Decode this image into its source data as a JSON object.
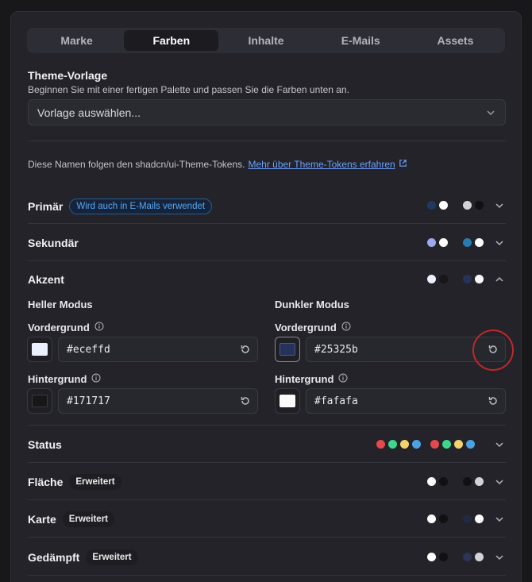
{
  "tabs": [
    "Marke",
    "Farben",
    "Inhalte",
    "E-Mails",
    "Assets"
  ],
  "active_tab": "Farben",
  "theme": {
    "title": "Theme-Vorlage",
    "description": "Beginnen Sie mit einer fertigen Palette und passen Sie die Farben unten an.",
    "select_placeholder": "Vorlage auswählen..."
  },
  "tokens_note": {
    "text": "Diese Namen folgen den shadcn/ui-Theme-Tokens.",
    "link": "Mehr über Theme-Tokens erfahren"
  },
  "rows": {
    "primary": {
      "title": "Primär",
      "badge": "Wird auch in E-Mails verwendet",
      "colors": [
        "#1e3a5f",
        "#ffffff",
        "#d4d4d8",
        "#111111"
      ]
    },
    "secondary": {
      "title": "Sekundär",
      "colors": [
        "#9aa9f0",
        "#ffffff",
        "#2a7ab0",
        "#ffffff"
      ]
    },
    "accent": {
      "title": "Akzent",
      "colors": [
        "#eceffd",
        "#171717",
        "#25325b",
        "#fafafa"
      ]
    },
    "status": {
      "title": "Status",
      "colors": [
        "#e5484d",
        "#3dd68c",
        "#f5d36c",
        "#4ba3e3",
        "#e5484d",
        "#3dd68c",
        "#f5d36c",
        "#4ba3e3"
      ]
    },
    "surface": {
      "title": "Fläche",
      "badge": "Erweitert",
      "colors": [
        "#ffffff",
        "#111111",
        "#111111",
        "#d4d4d8"
      ]
    },
    "card": {
      "title": "Karte",
      "badge": "Erweitert",
      "colors": [
        "#ffffff",
        "#111111",
        "#1f2a44",
        "#ffffff"
      ]
    },
    "muted": {
      "title": "Gedämpft",
      "badge": "Erweitert",
      "colors": [
        "#ffffff",
        "#111111",
        "#2c3556",
        "#d4d4d8"
      ]
    }
  },
  "accent_detail": {
    "light_mode": {
      "title": "Heller Modus",
      "foreground": {
        "label": "Vordergrund",
        "value": "#eceffd"
      },
      "background": {
        "label": "Hintergrund",
        "value": "#171717"
      }
    },
    "dark_mode": {
      "title": "Dunkler Modus",
      "foreground": {
        "label": "Vordergrund",
        "value": "#25325b"
      },
      "background": {
        "label": "Hintergrund",
        "value": "#fafafa"
      }
    }
  },
  "icons": {
    "info": "info-icon",
    "reset": "reset-icon",
    "chevron_down": "chevron-down-icon",
    "chevron_up": "chevron-up-icon",
    "external_link": "external-link-icon"
  },
  "highlight_color": "#c0282a"
}
